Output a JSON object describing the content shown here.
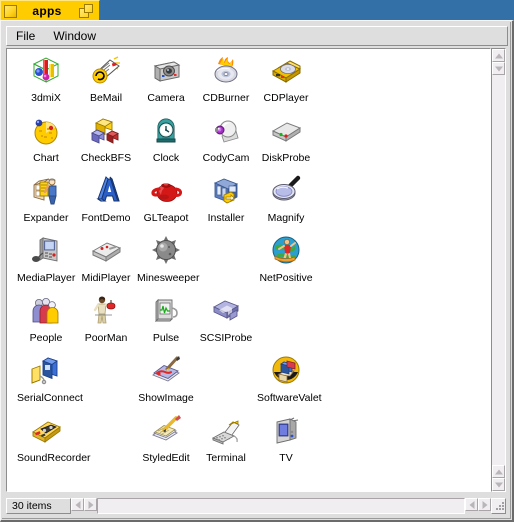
{
  "window": {
    "title": "apps",
    "close_icon": "close-box-icon",
    "zoom_icon": "zoom-box-icon",
    "accent_color": "#ffcc00",
    "desktop_color": "#3470a8"
  },
  "menubar": {
    "items": [
      {
        "label": "File"
      },
      {
        "label": "Window"
      }
    ]
  },
  "statusbar": {
    "count_label": "30 items",
    "scroll_left_icon": "scroll-left-arrow-icon",
    "scroll_right_icon": "scroll-right-arrow-icon",
    "resize_icon": "resize-grip-icon"
  },
  "scrollbar": {
    "up_icon": "scroll-up-arrow-icon",
    "down_icon": "scroll-down-arrow-icon"
  },
  "icons": [
    {
      "label": "3dmiX",
      "icon": "3dmix-icon",
      "col": 1,
      "row": 1
    },
    {
      "label": "BeMail",
      "icon": "bemail-icon",
      "col": 2,
      "row": 1
    },
    {
      "label": "Camera",
      "icon": "camera-icon",
      "col": 3,
      "row": 1
    },
    {
      "label": "CDBurner",
      "icon": "cdburner-icon",
      "col": 4,
      "row": 1
    },
    {
      "label": "CDPlayer",
      "icon": "cdplayer-icon",
      "col": 5,
      "row": 1
    },
    {
      "label": "Chart",
      "icon": "chart-icon",
      "col": 1,
      "row": 2
    },
    {
      "label": "CheckBFS",
      "icon": "checkbfs-icon",
      "col": 2,
      "row": 2
    },
    {
      "label": "Clock",
      "icon": "clock-icon",
      "col": 3,
      "row": 2
    },
    {
      "label": "CodyCam",
      "icon": "codycam-icon",
      "col": 4,
      "row": 2
    },
    {
      "label": "DiskProbe",
      "icon": "diskprobe-icon",
      "col": 5,
      "row": 2
    },
    {
      "label": "Expander",
      "icon": "expander-icon",
      "col": 1,
      "row": 3
    },
    {
      "label": "FontDemo",
      "icon": "fontdemo-icon",
      "col": 2,
      "row": 3
    },
    {
      "label": "GLTeapot",
      "icon": "glteapot-icon",
      "col": 3,
      "row": 3
    },
    {
      "label": "Installer",
      "icon": "installer-icon",
      "col": 4,
      "row": 3
    },
    {
      "label": "Magnify",
      "icon": "magnify-icon",
      "col": 5,
      "row": 3
    },
    {
      "label": "MediaPlayer",
      "icon": "mediaplayer-icon",
      "col": 1,
      "row": 4
    },
    {
      "label": "MidiPlayer",
      "icon": "midiplayer-icon",
      "col": 2,
      "row": 4
    },
    {
      "label": "Minesweeper",
      "icon": "minesweeper-icon",
      "col": 3,
      "row": 4
    },
    {
      "label": "NetPositive",
      "icon": "netpositive-icon",
      "col": 5,
      "row": 4
    },
    {
      "label": "People",
      "icon": "people-icon",
      "col": 1,
      "row": 5
    },
    {
      "label": "PoorMan",
      "icon": "poorman-icon",
      "col": 2,
      "row": 5
    },
    {
      "label": "Pulse",
      "icon": "pulse-icon",
      "col": 3,
      "row": 5
    },
    {
      "label": "SCSIProbe",
      "icon": "scsiprobe-icon",
      "col": 4,
      "row": 5
    },
    {
      "label": "SerialConnect",
      "icon": "serialconnect-icon",
      "col": 1,
      "row": 6
    },
    {
      "label": "ShowImage",
      "icon": "showimage-icon",
      "col": 3,
      "row": 6
    },
    {
      "label": "SoftwareValet",
      "icon": "softwarevalet-icon",
      "col": 5,
      "row": 6
    },
    {
      "label": "SoundRecorder",
      "icon": "soundrecorder-icon",
      "col": 1,
      "row": 7
    },
    {
      "label": "StyledEdit",
      "icon": "stylededit-icon",
      "col": 3,
      "row": 7
    },
    {
      "label": "Terminal",
      "icon": "terminal-icon",
      "col": 4,
      "row": 7
    },
    {
      "label": "TV",
      "icon": "tv-icon",
      "col": 5,
      "row": 7
    }
  ]
}
